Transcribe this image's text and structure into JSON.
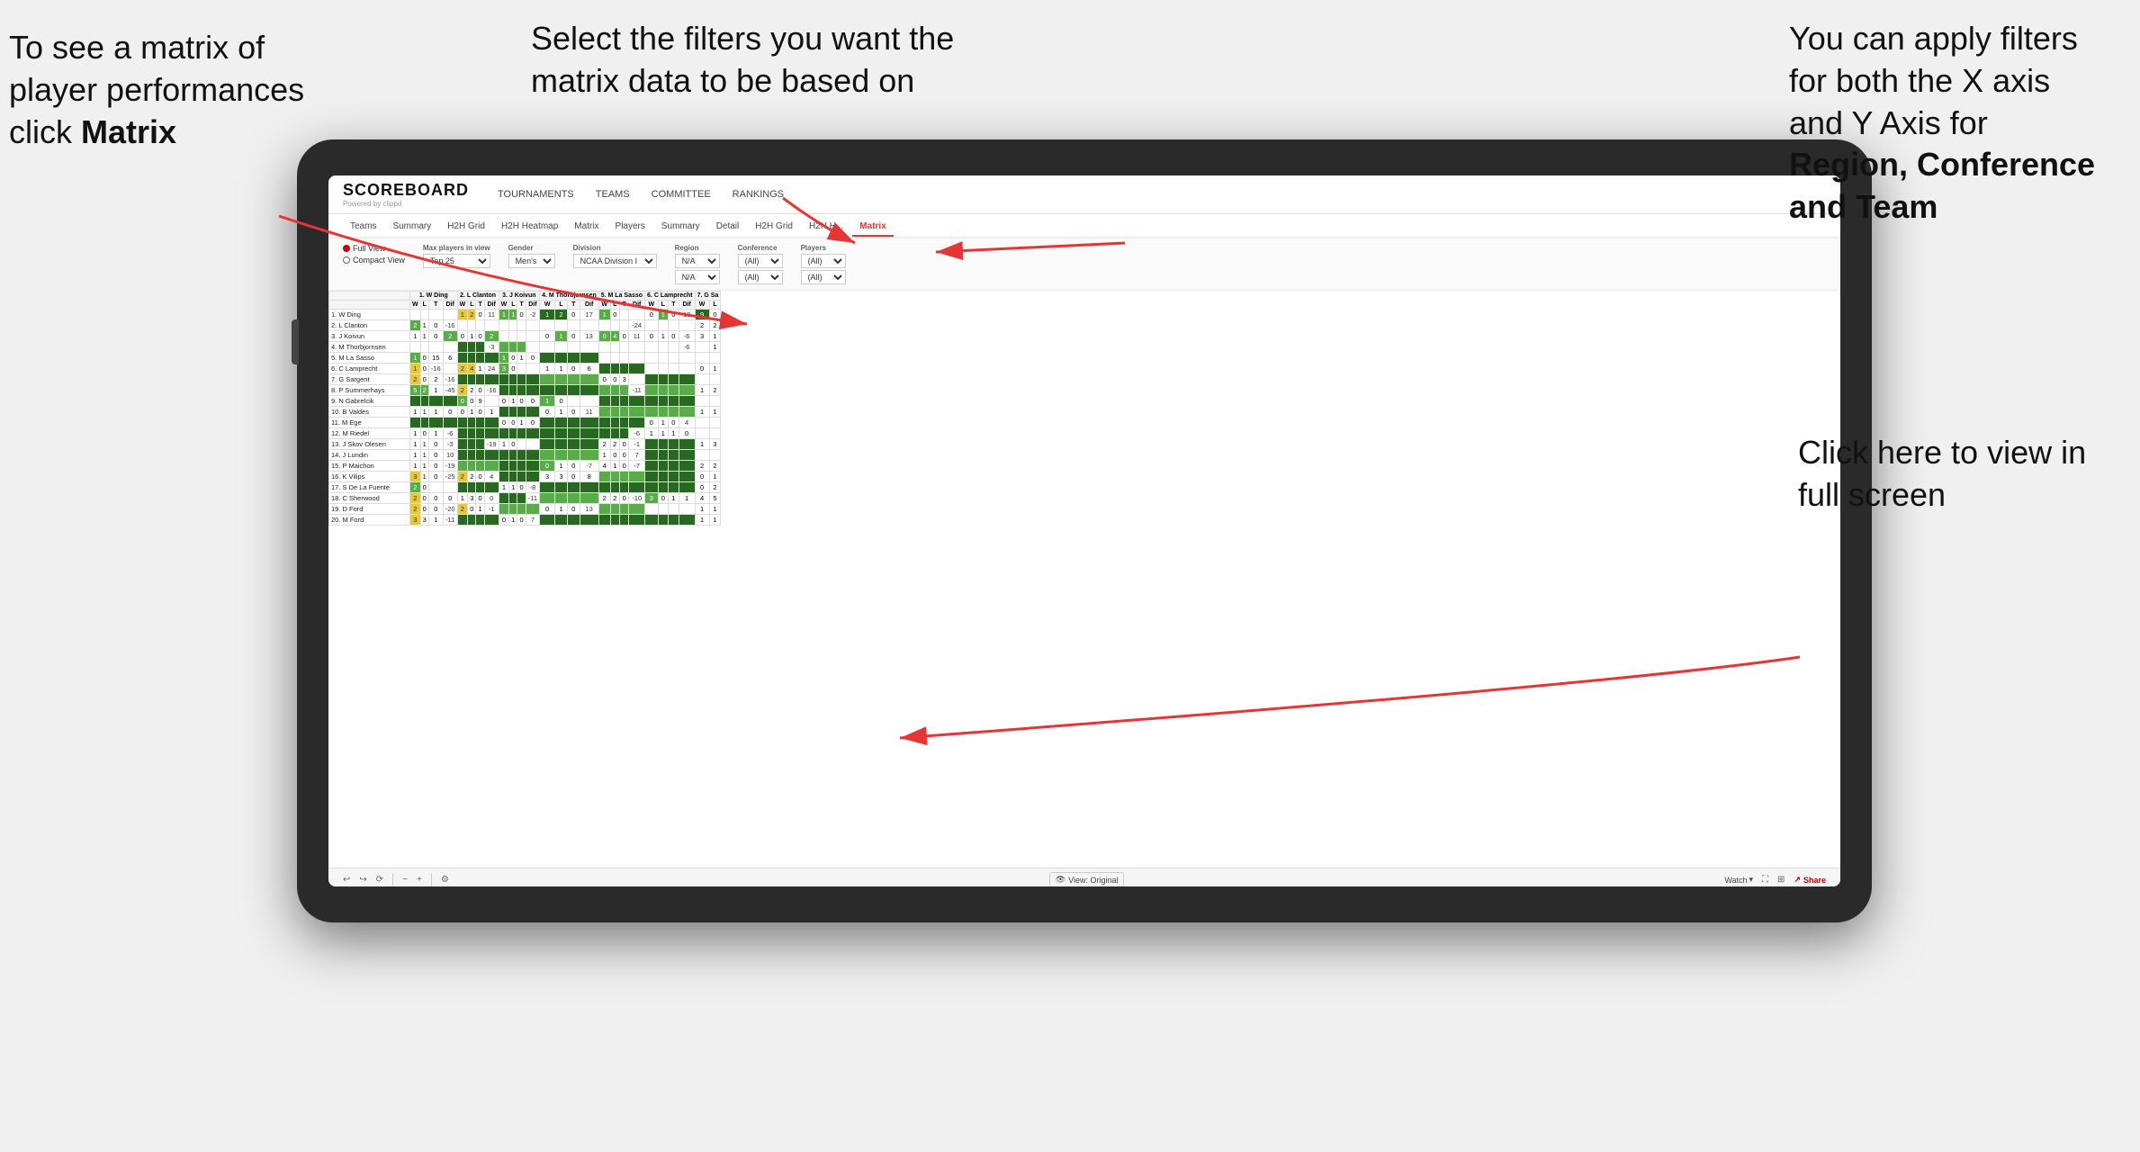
{
  "annotations": {
    "topleft": {
      "line1": "To see a matrix of",
      "line2": "player performances",
      "line3_normal": "click ",
      "line3_bold": "Matrix"
    },
    "topcenter": {
      "text": "Select the filters you want the matrix data to be based on"
    },
    "topright": {
      "line1": "You  can apply",
      "line2": "filters for both",
      "line3": "the X axis and Y",
      "line4_normal": "Axis for ",
      "line4_bold": "Region,",
      "line5_bold": "Conference and",
      "line6_bold": "Team"
    },
    "bottomright": {
      "line1": "Click here to view",
      "line2": "in full screen"
    }
  },
  "app": {
    "logo_main": "SCOREBOARD",
    "logo_sub": "Powered by clippd",
    "nav": [
      "TOURNAMENTS",
      "TEAMS",
      "COMMITTEE",
      "RANKINGS"
    ],
    "sub_nav": [
      "Teams",
      "Summary",
      "H2H Grid",
      "H2H Heatmap",
      "Matrix",
      "Players",
      "Summary",
      "Detail",
      "H2H Grid",
      "H2H H...",
      "Matrix"
    ],
    "active_tab": "Matrix"
  },
  "filters": {
    "view_full": "Full View",
    "view_compact": "Compact View",
    "max_players_label": "Max players in view",
    "max_players_value": "Top 25",
    "gender_label": "Gender",
    "gender_value": "Men's",
    "division_label": "Division",
    "division_value": "NCAA Division I",
    "region_label": "Region",
    "region_value1": "N/A",
    "region_value2": "N/A",
    "conference_label": "Conference",
    "conference_value1": "(All)",
    "conference_value2": "(All)",
    "players_label": "Players",
    "players_value1": "(All)",
    "players_value2": "(All)"
  },
  "toolbar": {
    "view_original": "View: Original",
    "watch": "Watch",
    "share": "Share"
  },
  "matrix": {
    "col_headers": [
      "1. W Ding",
      "2. L Clanton",
      "3. J Koivun",
      "4. M Thorbjornsen",
      "5. M La Sasso",
      "6. C Lamprecht",
      "7. G Sa"
    ],
    "sub_headers": [
      "W",
      "L",
      "T",
      "Dif"
    ],
    "rows": [
      {
        "name": "1. W Ding",
        "data": []
      },
      {
        "name": "2. L Clanton",
        "data": []
      },
      {
        "name": "3. J Koivun",
        "data": []
      },
      {
        "name": "4. M Thorbjornsen",
        "data": []
      },
      {
        "name": "5. M La Sasso",
        "data": []
      },
      {
        "name": "6. C Lamprecht",
        "data": []
      },
      {
        "name": "7. G Sargent",
        "data": []
      },
      {
        "name": "8. P Summerhays",
        "data": []
      },
      {
        "name": "9. N Gabrelcik",
        "data": []
      },
      {
        "name": "10. B Valdes",
        "data": []
      },
      {
        "name": "11. M Ege",
        "data": []
      },
      {
        "name": "12. M Riedel",
        "data": []
      },
      {
        "name": "13. J Skov Olesen",
        "data": []
      },
      {
        "name": "14. J Lundin",
        "data": []
      },
      {
        "name": "15. P Maichon",
        "data": []
      },
      {
        "name": "16. K Vilips",
        "data": []
      },
      {
        "name": "17. S De La Fuente",
        "data": []
      },
      {
        "name": "18. C Sherwood",
        "data": []
      },
      {
        "name": "19. D Ford",
        "data": []
      },
      {
        "name": "20. M Ford",
        "data": []
      }
    ]
  }
}
